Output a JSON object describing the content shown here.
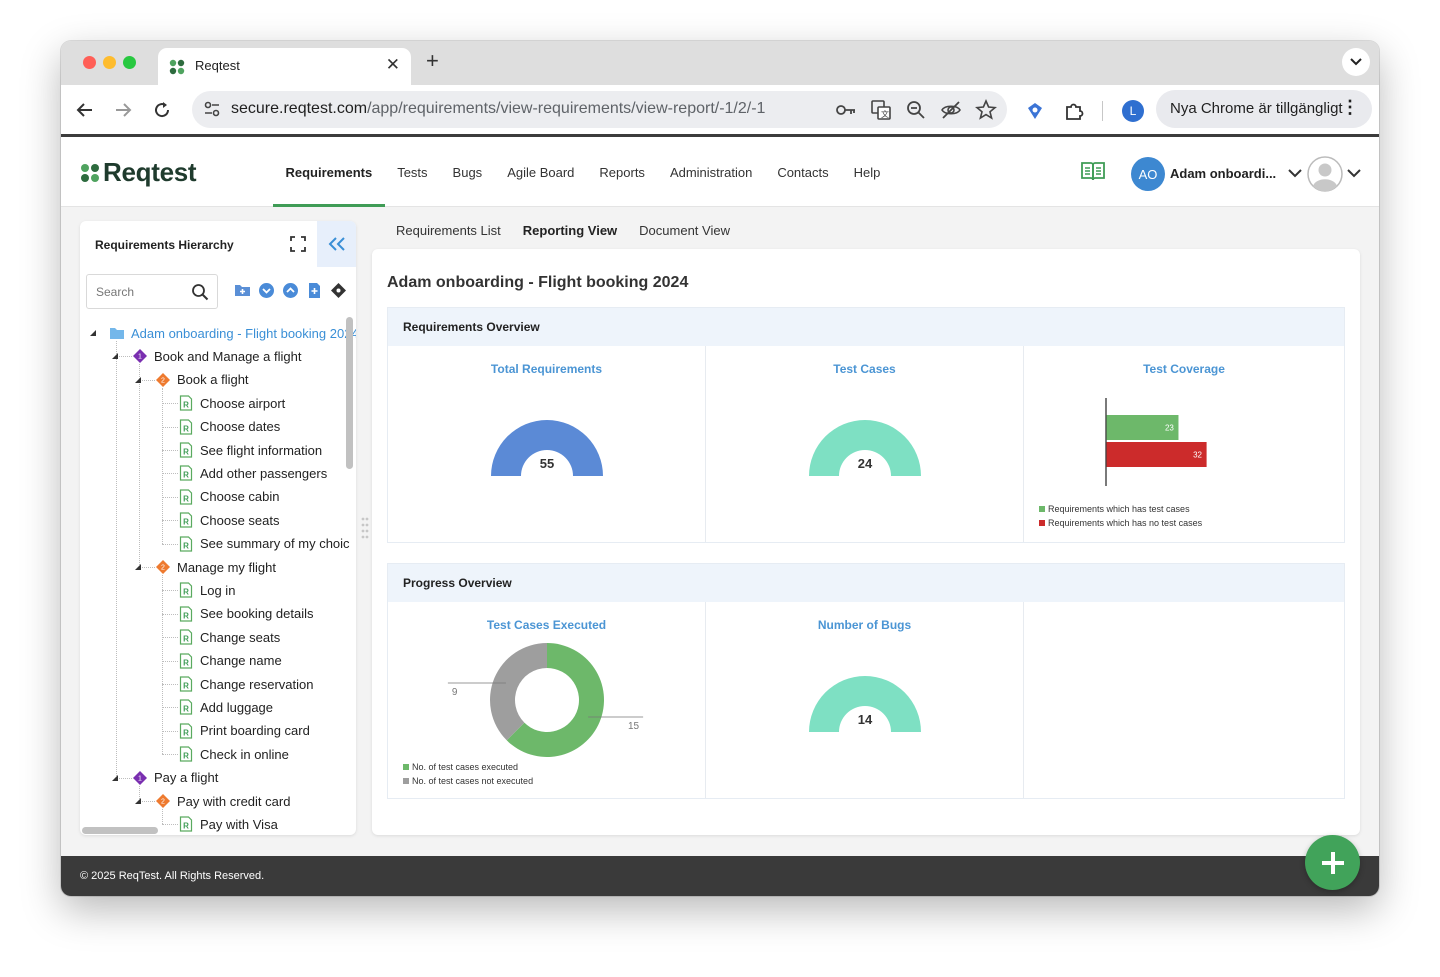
{
  "browser": {
    "tab_title": "Reqtest",
    "url_host": "secure.reqtest.com",
    "url_path": "/app/requirements/view-requirements/view-report/-1/2/-1",
    "profile_initial": "L",
    "update_label": "Nya Chrome är tillgängligt"
  },
  "app": {
    "logo_text": "Reqtest",
    "nav": [
      "Requirements",
      "Tests",
      "Bugs",
      "Agile Board",
      "Reports",
      "Administration",
      "Contacts",
      "Help"
    ],
    "active_nav": "Requirements",
    "user": {
      "initials": "AO",
      "name": "Adam onboardi..."
    }
  },
  "sidebar": {
    "title": "Requirements Hierarchy",
    "search_placeholder": "Search",
    "tree": [
      {
        "label": "Adam onboarding - Flight booking 2024",
        "type": "folder",
        "level": 0
      },
      {
        "label": "Book and Manage a flight",
        "type": "level1",
        "level": 1
      },
      {
        "label": "Book a flight",
        "type": "level2",
        "level": 2
      },
      {
        "label": "Choose airport",
        "type": "req",
        "level": 3
      },
      {
        "label": "Choose dates",
        "type": "req",
        "level": 3
      },
      {
        "label": "See flight information",
        "type": "req",
        "level": 3
      },
      {
        "label": "Add other passengers",
        "type": "req",
        "level": 3
      },
      {
        "label": "Choose cabin",
        "type": "req",
        "level": 3
      },
      {
        "label": "Choose seats",
        "type": "req",
        "level": 3
      },
      {
        "label": "See summary of my choic",
        "type": "req",
        "level": 3
      },
      {
        "label": "Manage my flight",
        "type": "level2",
        "level": 2
      },
      {
        "label": "Log in",
        "type": "req",
        "level": 3
      },
      {
        "label": "See booking details",
        "type": "req",
        "level": 3
      },
      {
        "label": "Change seats",
        "type": "req",
        "level": 3
      },
      {
        "label": "Change name",
        "type": "req",
        "level": 3
      },
      {
        "label": "Change reservation",
        "type": "req",
        "level": 3
      },
      {
        "label": "Add luggage",
        "type": "req",
        "level": 3
      },
      {
        "label": "Print boarding card",
        "type": "req",
        "level": 3
      },
      {
        "label": "Check in online",
        "type": "req",
        "level": 3
      },
      {
        "label": "Pay a flight",
        "type": "level1",
        "level": 1
      },
      {
        "label": "Pay with credit card",
        "type": "level2",
        "level": 2
      },
      {
        "label": "Pay with Visa",
        "type": "req",
        "level": 3
      }
    ]
  },
  "subnav": {
    "items": [
      "Requirements List",
      "Reporting View",
      "Document View"
    ],
    "active": "Reporting View"
  },
  "report": {
    "title": "Adam onboarding - Flight booking 2024",
    "requirements_overview": {
      "heading": "Requirements Overview",
      "total_requirements": {
        "title": "Total Requirements",
        "value": "55"
      },
      "test_cases": {
        "title": "Test Cases",
        "value": "24"
      },
      "test_coverage": {
        "title": "Test Coverage",
        "legend": [
          "Requirements which has test cases",
          "Requirements which has no test cases"
        ]
      }
    },
    "progress_overview": {
      "heading": "Progress Overview",
      "test_cases_executed": {
        "title": "Test Cases Executed",
        "legend": [
          "No. of test cases executed",
          "No. of test cases not executed"
        ]
      },
      "number_of_bugs": {
        "title": "Number of Bugs",
        "value": "14"
      }
    }
  },
  "colors": {
    "brand_green": "#3f9c56",
    "link_blue": "#4b95d4",
    "gauge_blue": "#5b8ad6",
    "gauge_teal": "#7ee0c3",
    "bar_green": "#6db86a",
    "bar_red": "#cc2b2b",
    "donut_grey": "#9e9e9e"
  },
  "chart_data": [
    {
      "type": "bar",
      "orientation": "horizontal",
      "title": "Test Coverage",
      "categories": [
        "Requirements which has test cases",
        "Requirements which has no test cases"
      ],
      "values": [
        23,
        32
      ],
      "legend_position": "bottom-left"
    },
    {
      "type": "pie",
      "title": "Test Cases Executed",
      "categories": [
        "No. of test cases executed",
        "No. of test cases not executed"
      ],
      "values": [
        15,
        9
      ],
      "legend_position": "bottom-left"
    }
  ],
  "footer": {
    "copyright": "© 2025 ReqTest. All Rights Reserved."
  }
}
